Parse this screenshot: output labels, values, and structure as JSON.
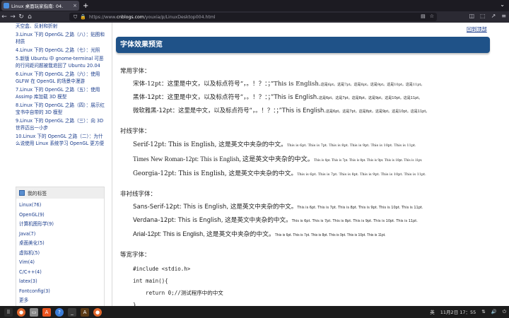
{
  "browser": {
    "tab_title": "Linux 桌面玩家指南: 04.",
    "tab_close": "×",
    "new_tab": "+",
    "url_prefix": "https://www.",
    "url_domain": "cnblogs.com",
    "url_path": "/youxia/p/LinuxDesktop004.html"
  },
  "sidebar": {
    "recent": [
      "天空盒、反射和折射",
      "3.Linux 下的 OpenGL 之路（八）：贴图和材质",
      "4.Linux 下的 OpenGL 之路（七）：光照",
      "5.新版 Ubuntu 中 gnome-terminal 可恶的行间距问题被我退回了 Ubuntu 20.04",
      "6.Linux 下的 OpenGL 之路（六）：使用 GLFW 在 OpenGL 的场景中漫游",
      "7.Linux 下的 OpenGL 之路（五）：使用 Assimp 库加载 3D 模型",
      "8.Linux 下的 OpenGL 之路（四）：展示红宝书中自带的 3D 模型",
      "9.Linux 下的 OpenGL 之路（三）：向 3D 世界迈出一小步",
      "10.Linux 下的 OpenGL 之路（二）：为什么说使用 Linux 系统学习 OpenGL 更方便"
    ],
    "tags_title": "我的标签",
    "tags": [
      "Linux(76)",
      "OpenGL(9)",
      "计算机图形学(9)",
      "Java(7)",
      "桌面美化(5)",
      "虚拟机(5)",
      "Vim(4)",
      "C/C++(4)",
      "latex(3)",
      "Fontconfig(3)",
      "更多"
    ]
  },
  "article": {
    "back_to_top": "回到顶部",
    "heading": "字体效果预览",
    "sections": [
      {
        "title": "常用字体：",
        "lines": [
          {
            "label": "宋体-12pt：这里是中文，以及标点符号“，。！？：；”This is English.",
            "small": "这是6pt。这是7pt。这是8pt。这是9pt。这是10pt。这是11pt。",
            "family": "serif"
          },
          {
            "label": "黑体-12pt：这里是中文，以及标点符号“，。！？：；”This is English.",
            "small": "这是6pt。这是7pt。这是8pt。这是9pt。这是10pt。这是11pt。",
            "family": "sans"
          },
          {
            "label": "微软雅黑-12pt：这里是中文，以及标点符号“，。！？：；”This is English.",
            "small": "这是6pt。这是7pt。这是8pt。这是9pt。这是10pt。这是11pt。",
            "family": "sans"
          }
        ]
      },
      {
        "title": "衬线字体：",
        "lines": [
          {
            "label": "Serif-12pt: This is English, 这是英文中夹杂的中文。",
            "small": "This is 6pt. This is 7pt. This is 8pt. This is 9pt. This is 10pt. This is 11pt.",
            "family": "serif"
          },
          {
            "label": "Times New Roman-12pt: This is English, 这是英文中夹杂的中文。",
            "small": "This is 6pt. This is 7pt. This is 8pt. This is 9pt. This is 10pt. This is 11pt.",
            "family": "serif"
          },
          {
            "label": "Georgia-12pt: This is English, 这是英文中夹杂的中文。",
            "small": "This is 6pt. This is 7pt. This is 8pt. This is 9pt. This is 10pt. This is 11pt.",
            "family": "serif"
          }
        ]
      },
      {
        "title": "非衬线字体：",
        "lines": [
          {
            "label": "Sans-Serif-12pt: This is English, 这是英文中夹杂的中文。",
            "small": "This is 6pt. This is 7pt. This is 8pt. This is 9pt. This is 10pt. This is 11pt.",
            "family": "sans"
          },
          {
            "label": "Verdana-12pt: This is English, 这是英文中夹杂的中文。",
            "small": "This is 6pt. This is 7pt. This is 8pt. This is 9pt. This is 10pt. This is 11pt.",
            "family": "sans"
          },
          {
            "label": "Arial-12pt: This is English, 这是英文中夹杂的中文。",
            "small": "This is 6pt. This is 7pt. This is 8pt. This is 9pt. This is 10pt. This is 11pt.",
            "family": "sans"
          }
        ]
      }
    ],
    "mono_title": "等宽字体：",
    "code": [
      "#include <stdio.h>",
      "int main(){",
      "    return 0;//测试程序中的中文",
      "}"
    ]
  },
  "taskbar": {
    "ime": "英",
    "datetime": "11月2日 17：55"
  }
}
